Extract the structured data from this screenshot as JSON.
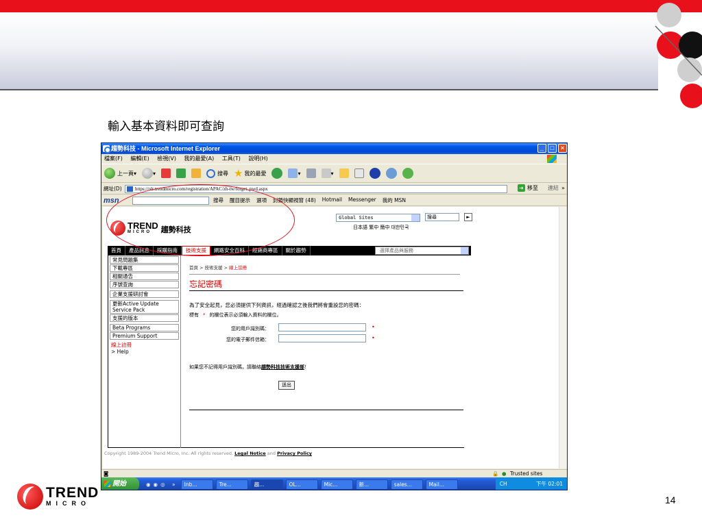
{
  "slide": {
    "title": "輸入基本資料即可查詢",
    "page_number": "14",
    "brand": {
      "main": "TREND",
      "sub": "MICRO"
    },
    "colors": {
      "accent": "#e8101a",
      "link_red": "#dd0000",
      "xp_blue": "#0055e5"
    }
  },
  "browser": {
    "title": "趨勢科技 - Microsoft Internet Explorer",
    "menu": [
      "檔案(F)",
      "編輯(E)",
      "檢視(V)",
      "我的最愛(A)",
      "工具(T)",
      "說明(H)"
    ],
    "toolbar": {
      "back": "上一頁",
      "search": "搜尋",
      "favorites": "我的最愛"
    },
    "address_label": "網址(D)",
    "address": "https://olr.trendmicro.com/registration/APAC/zh-tw/forget_pwd.aspx",
    "go": "移至",
    "links": "連結",
    "msn": {
      "logo": "msn",
      "search": "搜尋",
      "highlight": "醒目提示",
      "options": "選項",
      "popup": "封鎖快顯視窗 (48)",
      "hotmail": "Hotmail",
      "messenger": "Messenger",
      "mymsn": "我的 MSN"
    },
    "status": {
      "zone": "Trusted sites"
    },
    "taskbar": {
      "start": "開始",
      "tasks": [
        "Inb...",
        "Tre...",
        "趨...",
        "OL...",
        "Mic...",
        "新...",
        "sales...",
        "Mail..."
      ],
      "clock": "下午 02:01",
      "lang": "CH"
    }
  },
  "site": {
    "brand_cn": "趨勢科技",
    "global_sites": "Global Sites",
    "search_value": "搜尋",
    "languages": "日本語  繁中  簡中  대한민국",
    "nav": [
      "首頁",
      "產品訊息",
      "採購指南",
      "技術支援",
      "網路安全百科",
      "經銷商專區",
      "關於趨勢"
    ],
    "nav_active_index": 3,
    "nav_select": "選擇產品與服務",
    "sidebar": [
      "常見問題集",
      "下載專區",
      "相關通告",
      "序號查詢",
      "企業支援研討會",
      "更新Active Update Service Pack",
      "支援的版本",
      "Beta Programs",
      "Premium Support"
    ],
    "sidebar_active": "線上註冊",
    "sidebar_help": "> Help",
    "breadcrumb": {
      "path": "首頁 > 技術支援 > ",
      "current": "線上註冊"
    },
    "page_title": "忘記密碼",
    "intro": "為了安全起見，您必須提供下列資訊，經過確認之後我們將會重設您的密碼：",
    "required_note": {
      "prefix": "標有",
      "star": "*",
      "suffix": "的欄位表示必須輸入資料的欄位。"
    },
    "fields": [
      {
        "label": "您的用戶識別碼："
      },
      {
        "label": "您的電子郵件信箱："
      }
    ],
    "forgot_text": "如果您不記得用戶識別碼，請聯絡",
    "forgot_link": "趨勢科技技術支援部",
    "forgot_suffix": "！",
    "submit": "送出",
    "copyright": "Copyright 1989-2004 Trend Micro, Inc. All rights reserved.",
    "legal": "Legal Notice",
    "and": "and",
    "privacy": "Privacy Policy"
  }
}
